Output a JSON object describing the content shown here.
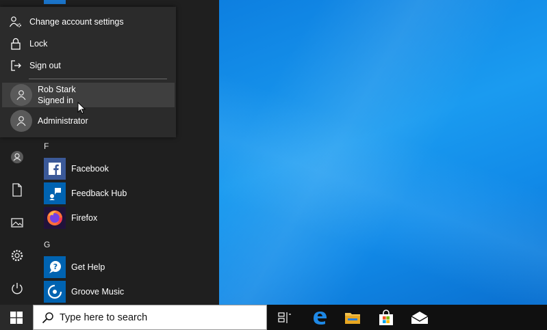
{
  "flyout": {
    "items": [
      {
        "label": "Change account settings",
        "icon": "account-settings-icon"
      },
      {
        "label": "Lock",
        "icon": "lock-icon"
      },
      {
        "label": "Sign out",
        "icon": "sign-out-icon"
      }
    ],
    "users": [
      {
        "name": "Rob Stark",
        "status": "Signed in"
      },
      {
        "name": "Administrator"
      }
    ]
  },
  "applist": {
    "groups": [
      {
        "letter": "F",
        "apps": [
          "Facebook",
          "Feedback Hub",
          "Firefox"
        ]
      },
      {
        "letter": "G",
        "apps": [
          "Get Help",
          "Groove Music"
        ]
      }
    ]
  },
  "rail": [
    "user-icon",
    "documents-icon",
    "pictures-icon",
    "settings-icon",
    "power-icon"
  ],
  "taskbar": {
    "search_placeholder": "Type here to search",
    "pinned": [
      "task-view-icon",
      "edge-icon",
      "file-explorer-icon",
      "store-icon",
      "mail-icon"
    ]
  },
  "colors": {
    "accent": "#0063b1",
    "desktop": "#1a9bf0",
    "start_bg": "#1f1f1f",
    "flyout_bg": "#2b2b2b"
  }
}
